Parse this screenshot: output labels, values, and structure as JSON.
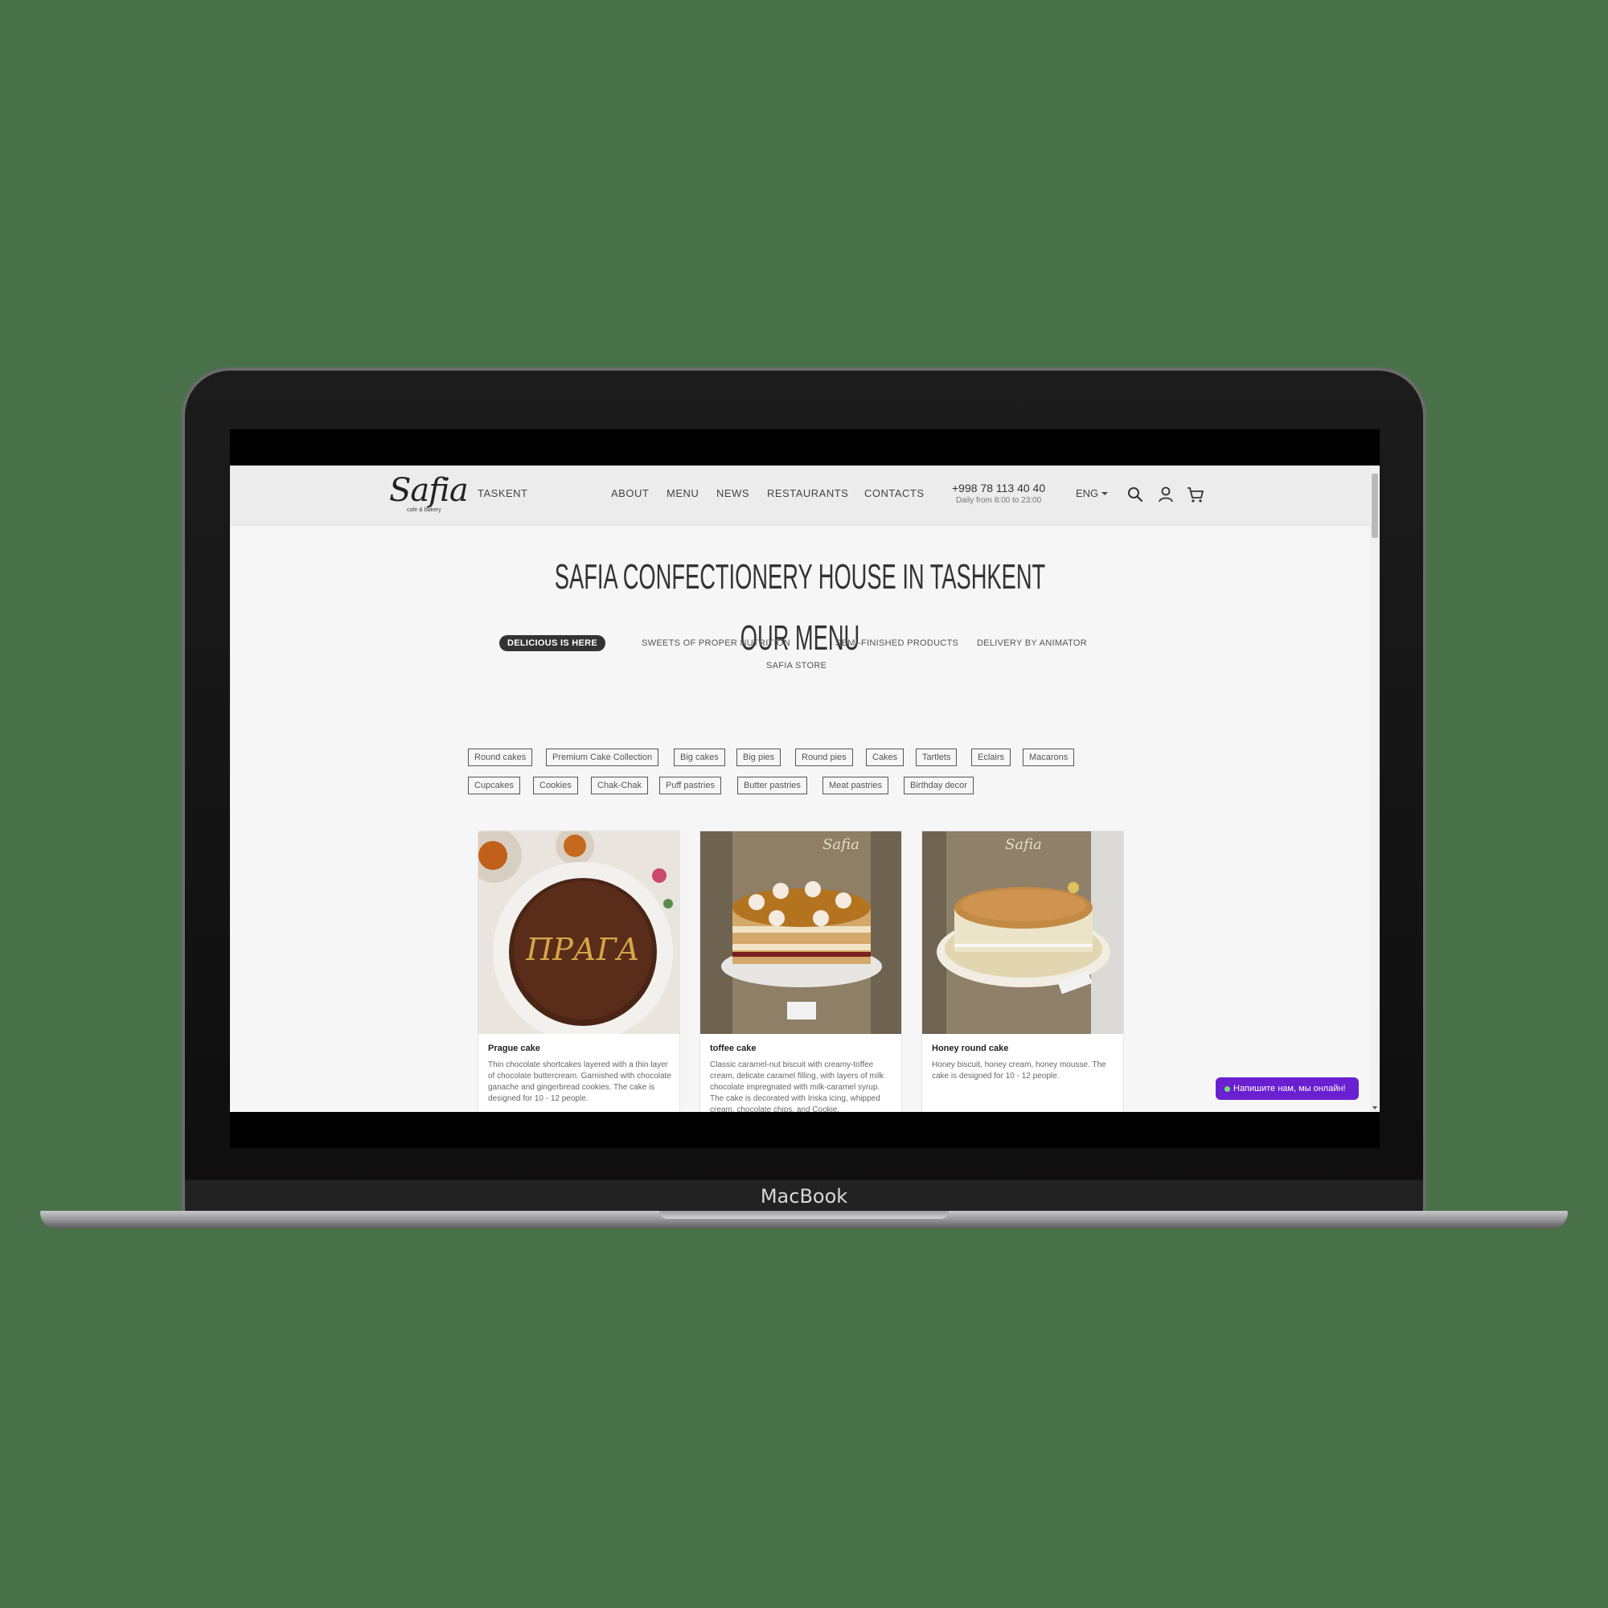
{
  "device": {
    "brand": "MacBook"
  },
  "header": {
    "logo": "Safia",
    "logo_sub": "cafe & bakery",
    "city": "TASKENT",
    "nav": [
      "ABOUT",
      "MENU",
      "NEWS",
      "RESTAURANTS",
      "CONTACTS"
    ],
    "phone": "+998 78 113 40 40",
    "hours": "Daily from 8:00 to 23:00",
    "lang": "ENG",
    "icons": [
      "search-icon",
      "user-icon",
      "cart-icon"
    ]
  },
  "title": "SAFIA CONFECTIONERY HOUSE IN TASHKENT",
  "subtitle": "OUR MENU",
  "tabs": [
    "DELICIOUS IS HERE",
    "SWEETS OF PROPER NUTRITION",
    "SEMI-FINISHED PRODUCTS",
    "DELIVERY BY ANIMATOR",
    "SAFIA STORE"
  ],
  "active_tab": "DELICIOUS IS HERE",
  "categories": [
    "Round cakes",
    "Premium Cake Collection",
    "Big cakes",
    "Big pies",
    "Round pies",
    "Cakes",
    "Tartlets",
    "Eclairs",
    "Macarons",
    "Cupcakes",
    "Cookies",
    "Chak-Chak",
    "Puff pastries",
    "Butter pastries",
    "Meat pastries",
    "Birthday decor"
  ],
  "products": [
    {
      "name": "Prague cake",
      "desc": "Thin chocolate shortcakes layered with a thin layer of chocolate buttercream. Garnished with chocolate ganache and gingerbread cookies. The cake is designed for 10 - 12 people.",
      "image_text": "ПРАГА"
    },
    {
      "name": "toffee cake",
      "desc": "Classic caramel-nut biscuit with creamy-toffee cream, delicate caramel filling, with layers of milk chocolate impregnated with milk-caramel syrup. The cake is decorated with Iriska icing, whipped cream, chocolate chips, and Cookie.",
      "image_text": "Safia"
    },
    {
      "name": "Honey round cake",
      "desc": "Honey biscuit, honey cream, honey mousse. The cake is designed for 10 - 12 people.",
      "image_text": "Safia"
    }
  ],
  "chat": {
    "label": "Напишите нам, мы онлайн!"
  },
  "colors": {
    "background": "#497149",
    "chat": "#6a1fd1",
    "active_tab": "#333333"
  }
}
